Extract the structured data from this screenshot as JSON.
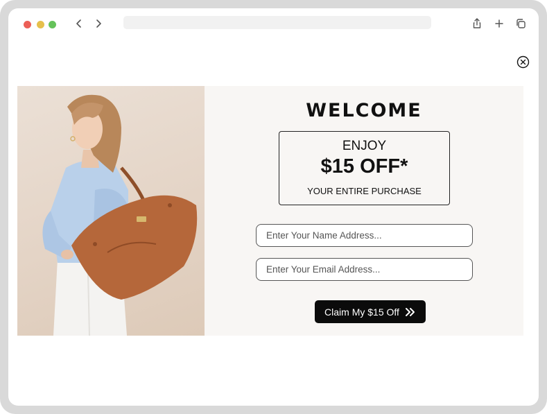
{
  "popup": {
    "close_icon": "close-circle-icon",
    "welcome": "WELCOME",
    "offer": {
      "enjoy": "ENJOY",
      "amount": "$15 OFF*",
      "scope": "YOUR ENTIRE PURCHASE"
    },
    "name_placeholder": "Enter Your Name Address...",
    "email_placeholder": "Enter Your Email Address...",
    "cta_label": "Claim My $15 Off",
    "cta_icon": "double-chevron-right-icon",
    "hero_image": "model-with-brown-leather-tote-bag"
  },
  "colors": {
    "popup_bg": "#f8f6f4",
    "cta_bg": "#0b0b0b",
    "bag": "#b5673a",
    "shirt": "#b9d0ea"
  }
}
